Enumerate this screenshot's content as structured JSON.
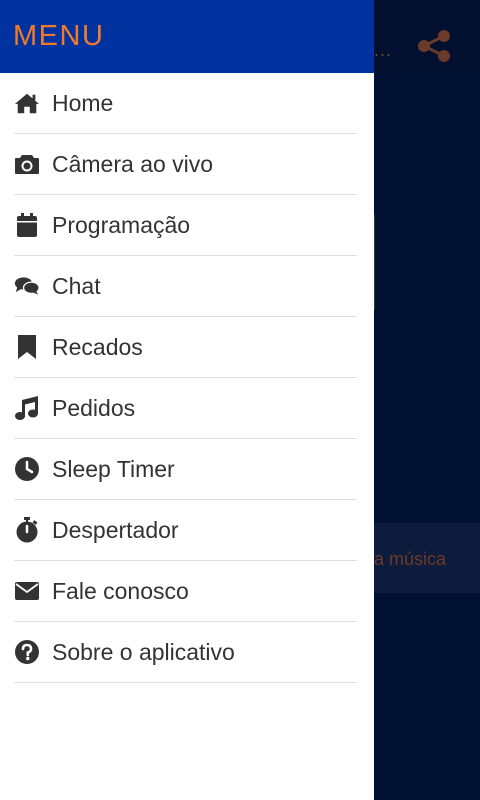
{
  "drawer": {
    "title": "MENU",
    "items": [
      {
        "label": "Home",
        "icon": "home-icon"
      },
      {
        "label": "Câmera ao vivo",
        "icon": "camera-icon"
      },
      {
        "label": "Programação",
        "icon": "calendar-icon"
      },
      {
        "label": "Chat",
        "icon": "chat-icon"
      },
      {
        "label": "Recados",
        "icon": "bookmark-icon"
      },
      {
        "label": "Pedidos",
        "icon": "music-icon"
      },
      {
        "label": "Sleep Timer",
        "icon": "clock-icon"
      },
      {
        "label": "Despertador",
        "icon": "stopwatch-icon"
      },
      {
        "label": "Fale conosco",
        "icon": "envelope-icon"
      },
      {
        "label": "Sobre o aplicativo",
        "icon": "question-icon"
      }
    ]
  },
  "background": {
    "truncated_title": "...",
    "panel_text": "a música"
  },
  "colors": {
    "header_bg": "#0033a0",
    "header_text": "#f07a2b",
    "icon": "#333333",
    "app_bg": "#011133"
  }
}
